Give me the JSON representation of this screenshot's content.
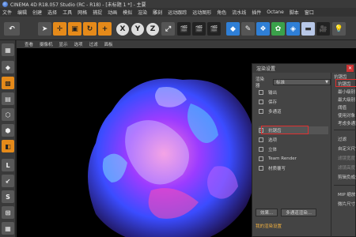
{
  "window": {
    "title": "CINEMA 4D R18.057 Studio (RC - R18) - [未标题 1 *] - 主要"
  },
  "menubar": {
    "items": [
      "文件",
      "编辑",
      "创建",
      "选择",
      "工具",
      "网格",
      "捕捉",
      "动画",
      "模拟",
      "渲染",
      "雕刻",
      "运动跟踪",
      "运动图形",
      "角色",
      "流水线",
      "插件",
      "Octane",
      "脚本",
      "窗口"
    ]
  },
  "toolbar": {
    "undo_icon": "undo-icon",
    "x_label": "X",
    "y_label": "Y",
    "z_label": "Z"
  },
  "viewport": {
    "menu": [
      "查看",
      "摄像机",
      "显示",
      "选项",
      "过滤",
      "面板"
    ]
  },
  "render_settings": {
    "title": "渲染设置",
    "renderer_label": "渲染器",
    "renderer_value": "标准",
    "options": [
      {
        "label": "输出",
        "checked": false
      },
      {
        "label": "保存",
        "checked": false
      },
      {
        "label": "多通道",
        "checked": false
      },
      {
        "label": "抗锯齿",
        "checked": true
      },
      {
        "label": "选项",
        "checked": false
      },
      {
        "label": "立体",
        "checked": false
      },
      {
        "label": "Team Render",
        "checked": false
      },
      {
        "label": "材质覆写",
        "checked": false
      }
    ],
    "effect_button": "效果...",
    "multipass_button": "多通道渲染...",
    "preset_label": "我的渲染设置",
    "right_pane": {
      "header": "抗锯齿",
      "items": [
        "抗锯齿",
        "最小级别",
        "最大级别",
        "阈值",
        "使用对象",
        "考虑多通道",
        "过滤",
        "自定义尺寸",
        "滤镜宽度",
        "滤镜高度",
        "剪辑负成分",
        "MIP 缩放",
        "微片尺寸"
      ]
    }
  },
  "colors": {
    "accent_orange": "#e58a1a",
    "highlight_red": "#e03030",
    "preset_text": "#f0b040"
  }
}
